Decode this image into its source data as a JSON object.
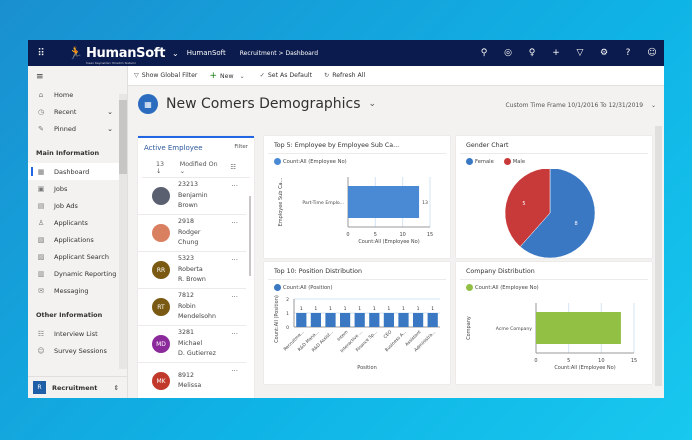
{
  "topbar": {
    "brand": "HumanSoft",
    "tagline": "İnsan Kaynakları Yönetim Sistemi",
    "app": "HumanSoft",
    "breadcrumb": "Recruitment  >  Dashboard",
    "icons": [
      "search-icon",
      "target-icon",
      "lightbulb-icon",
      "plus-icon",
      "filter-icon",
      "settings-icon",
      "help-icon",
      "user-icon"
    ]
  },
  "commandbar": {
    "show_filter": "Show Global Filter",
    "new": "New",
    "set_default": "Set As Default",
    "refresh": "Refresh All"
  },
  "sidebar": {
    "top": [
      {
        "label": "Home",
        "icon": "⌂"
      },
      {
        "label": "Recent",
        "icon": "◷"
      },
      {
        "label": "Pinned",
        "icon": "✎"
      }
    ],
    "main_header": "Main Information",
    "main": [
      {
        "label": "Dashboard",
        "icon": "▦"
      },
      {
        "label": "Jobs",
        "icon": "▣"
      },
      {
        "label": "Job Ads",
        "icon": "▤"
      },
      {
        "label": "Applicants",
        "icon": "♙"
      },
      {
        "label": "Applications",
        "icon": "▧"
      },
      {
        "label": "Applicant Search",
        "icon": "▨"
      },
      {
        "label": "Dynamic Reporting",
        "icon": "▥"
      },
      {
        "label": "Messaging",
        "icon": "✉"
      }
    ],
    "other_header": "Other Information",
    "other": [
      {
        "label": "Interview List",
        "icon": "☷"
      },
      {
        "label": "Survey Sessions",
        "icon": "☺"
      }
    ],
    "area_badge": "R",
    "area": "Recruitment"
  },
  "page": {
    "title": "New Comers Demographics",
    "timeframe": "Custom Time Frame 10/1/2016 To 12/31/2019"
  },
  "employees": {
    "title": "Active Employee",
    "filter": "Filter",
    "count": "13",
    "sort_field": "Modified On",
    "rows": [
      {
        "id": "23213",
        "first": "Benjamin",
        "last": "Brown",
        "initials": "",
        "color": "#5a6070"
      },
      {
        "id": "2918",
        "first": "Rodger",
        "last": "Chung",
        "initials": "",
        "color": "#d98060"
      },
      {
        "id": "5323",
        "first": "Roberta",
        "last": "R. Brown",
        "initials": "RR",
        "color": "#7a5a12"
      },
      {
        "id": "7812",
        "first": "Robin",
        "last": "Mendelsohn",
        "initials": "RT",
        "color": "#7a5a12"
      },
      {
        "id": "3281",
        "first": "Michael",
        "last": "D. Gutierrez",
        "initials": "MD",
        "color": "#8b2a9b"
      },
      {
        "id": "8912",
        "first": "Melissa",
        "last": "",
        "initials": "MK",
        "color": "#c0392b"
      }
    ]
  },
  "chart_data": [
    {
      "type": "bar",
      "orientation": "horizontal",
      "title": "Top 5: Employee by Employee Sub Ca...",
      "legend": [
        "Count:All (Employee No)"
      ],
      "categories": [
        "Part-Time Emplo..."
      ],
      "values": [
        13
      ],
      "xlabel": "Count:All (Employee No)",
      "ylabel": "Employee Sub Ca...",
      "xlim": [
        0,
        15
      ],
      "ticks": [
        0,
        5,
        10,
        15
      ],
      "color": "#4a8ad4"
    },
    {
      "type": "pie",
      "title": "Gender Chart",
      "categories": [
        "Female",
        "Male"
      ],
      "values": [
        8,
        5
      ],
      "colors": [
        "#3a78c4",
        "#c83a3a"
      ]
    },
    {
      "type": "bar",
      "title": "Top 10: Position Distribution",
      "legend": [
        "Count:All (Position)"
      ],
      "categories": [
        "Recruitme...",
        "R&D Mana...",
        "R&D Assist...",
        "Intern",
        "Interactive ...",
        "Finance Sp...",
        "CEO",
        "Business A...",
        "Assistant",
        "Administra..."
      ],
      "values": [
        1,
        1,
        1,
        1,
        1,
        1,
        1,
        1,
        1,
        1
      ],
      "xlabel": "Position",
      "ylabel": "Count:All (Position)",
      "ylim": [
        0,
        2
      ],
      "ticks": [
        0,
        1,
        2
      ],
      "color": "#3a78c4"
    },
    {
      "type": "bar",
      "orientation": "horizontal",
      "title": "Company Distribution",
      "legend": [
        "Count:All (Employee No)"
      ],
      "categories": [
        "Acme Company"
      ],
      "values": [
        13
      ],
      "xlabel": "Count:All (Employee No)",
      "ylabel": "Company",
      "xlim": [
        0,
        15
      ],
      "ticks": [
        0,
        5,
        10,
        15
      ],
      "color": "#92c045"
    }
  ]
}
